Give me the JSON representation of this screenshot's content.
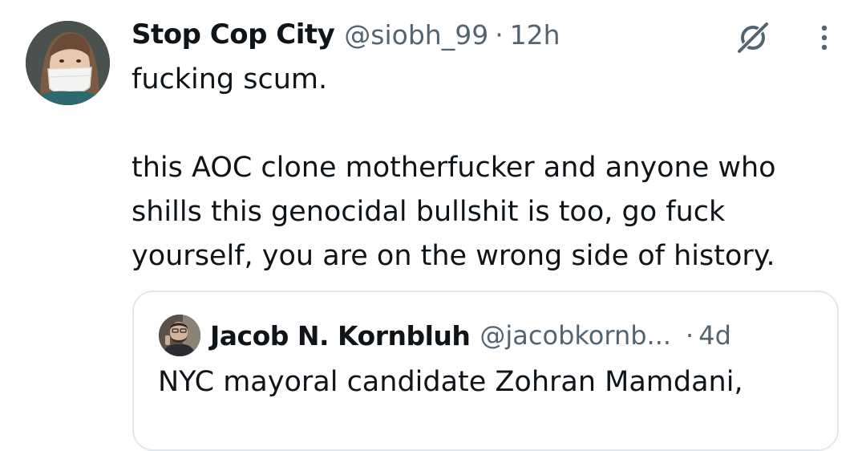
{
  "tweet": {
    "author_name": "Stop Cop City",
    "handle": "@siobh_99",
    "separator": "·",
    "time": "12h",
    "lines": [
      "fucking scum.",
      "",
      "this AOC clone motherfucker and anyone who",
      "shills this genocidal bullshit is too, go fuck",
      "yourself, you are on the wrong side of history."
    ],
    "avatar_icon": "masked-person-avatar",
    "grok_icon": "grok-icon",
    "more_icon": "more-vertical-icon"
  },
  "quoted": {
    "author_name": "Jacob N. Kornbluh",
    "handle": "@jacobkornb...",
    "separator": "·",
    "time": "4d",
    "text": "NYC mayoral candidate Zohran Mamdani,",
    "avatar_icon": "bearded-person-avatar"
  },
  "colors": {
    "text": "#0f1419",
    "secondary": "#536471",
    "border": "#e1e8ed"
  }
}
